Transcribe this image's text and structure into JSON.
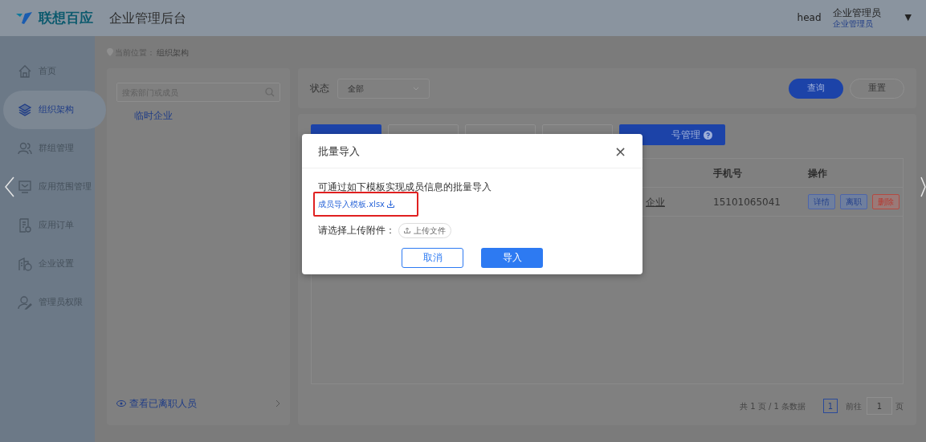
{
  "header": {
    "brand": "联想百应",
    "title": "企业管理后台",
    "avatar_alt": "head",
    "user_name": "企业管理员",
    "user_role": "企业管理员",
    "menu_caret": "▼"
  },
  "sidebar": {
    "items": [
      {
        "label": "首页",
        "selected": false
      },
      {
        "label": "组织架构",
        "selected": true
      },
      {
        "label": "群组管理",
        "selected": false
      },
      {
        "label": "应用范围管理",
        "selected": false
      },
      {
        "label": "应用订单",
        "selected": false
      },
      {
        "label": "企业设置",
        "selected": false
      },
      {
        "label": "管理员权限",
        "selected": false
      }
    ]
  },
  "breadcrumb": {
    "prefix": "当前位置：",
    "current": "组织架构"
  },
  "org_panel": {
    "search": {
      "placeholder": "搜索部门或成员"
    },
    "tree": [
      {
        "label": "临时企业"
      }
    ],
    "footer_link": "查看已离职人员"
  },
  "filter": {
    "label": "状态",
    "select_value": "全部",
    "buttons": [
      {
        "label": "查询",
        "kind": "primary"
      },
      {
        "label": "重置",
        "kind": "outline"
      }
    ]
  },
  "toolbar": [
    {
      "kind": "primary"
    },
    {
      "kind": "outline"
    },
    {
      "kind": "outline"
    },
    {
      "kind": "outline"
    },
    {
      "label": "号管理",
      "kind": "primary",
      "help": true
    }
  ],
  "table": {
    "columns": [
      "手机号",
      "操作"
    ],
    "rows": [
      {
        "department": "企业",
        "phone": "15101065041",
        "actions": [
          {
            "label": "详情",
            "kind": "info"
          },
          {
            "label": "离职",
            "kind": "info"
          },
          {
            "label": "删除",
            "kind": "danger"
          }
        ]
      }
    ]
  },
  "pagination": {
    "summary": "共 1 页 / 1 条数据",
    "pages": [
      {
        "label": "1",
        "selected": true
      }
    ],
    "goto_label": "前往",
    "goto_value": "1",
    "goto_suffix": "页"
  },
  "modal": {
    "title": "批量导入",
    "close": "×",
    "description": "可通过如下模板实现成员信息的批量导入",
    "template_link": "成员导入模板.xlsx",
    "highlighted": true,
    "upload_label": "请选择上传附件：",
    "upload_button": "上传文件",
    "buttons": [
      {
        "label": "取消",
        "kind": "outline"
      },
      {
        "label": "导入",
        "kind": "primary"
      }
    ]
  }
}
